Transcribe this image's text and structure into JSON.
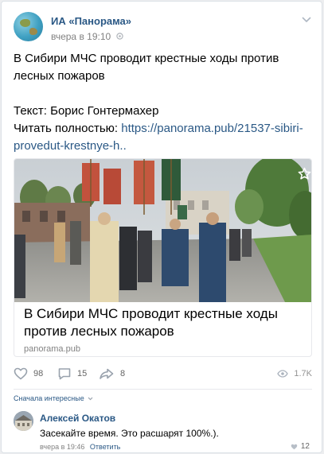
{
  "post": {
    "group_name": "ИА «Панорама»",
    "time": "вчера в 19:10",
    "text_lines": [
      "В Сибири МЧС проводит крестные ходы против",
      "лесных пожаров"
    ],
    "author_line": "Текст: Борис Гонтермахер",
    "read_more_label": "Читать полностью: ",
    "link_line1": "https://panorama.pub/21537-sibiri-",
    "link_line2": "provedut-krestnye-h.."
  },
  "attachment": {
    "title_line1": "В Сибири МЧС проводит крестные ходы",
    "title_line2": "против лесных пожаров",
    "domain": "panorama.pub"
  },
  "actions": {
    "likes": "98",
    "comments": "15",
    "shares": "8",
    "views": "1.7K"
  },
  "comments": {
    "sort_label": "Сначала интересные",
    "items": [
      {
        "author": "Алексей Окатов",
        "text": "Засекайте время. Это расшарят 100%.).",
        "time": "вчера в 19:46",
        "reply_label": "Ответить",
        "likes": "12"
      }
    ]
  },
  "icons": {
    "more": "chevron-down-icon",
    "pin": "pin-icon",
    "fave": "star-icon",
    "like": "heart-icon",
    "comment": "comment-icon",
    "share": "share-arrow-icon",
    "views": "eye-icon"
  },
  "colors": {
    "link": "#2a5885",
    "muted": "#828282",
    "border": "#e7e8ec",
    "background": "#edeef0"
  }
}
